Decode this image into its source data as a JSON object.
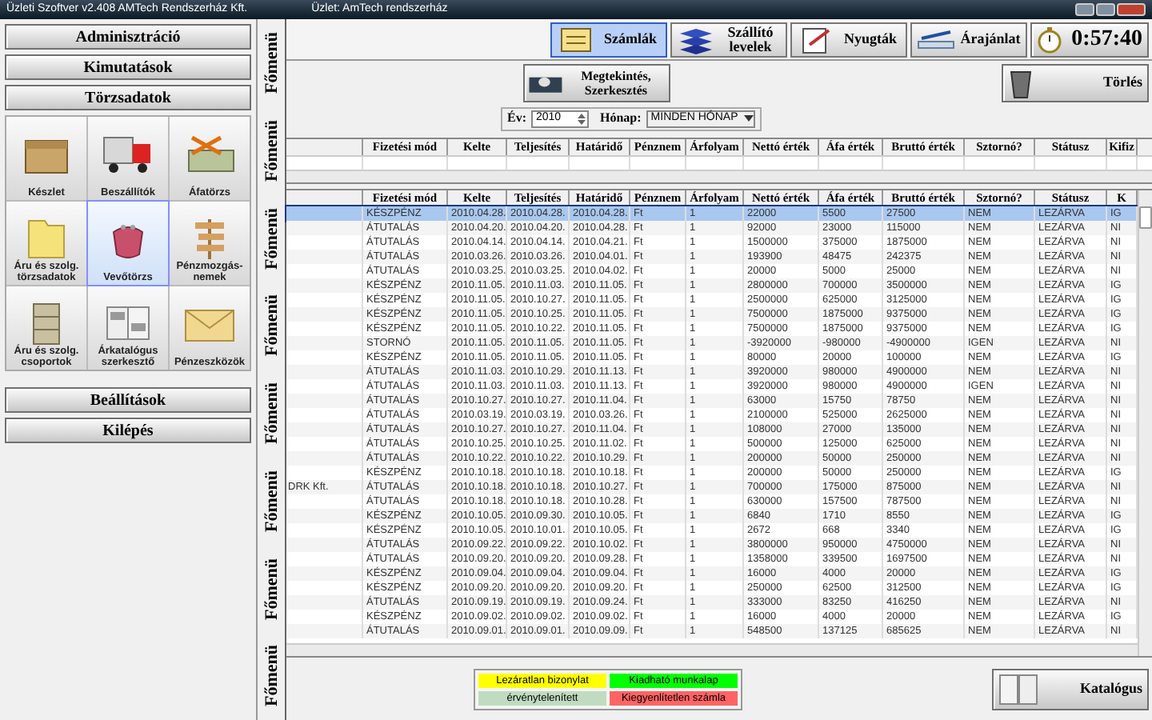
{
  "window": {
    "title": "Üzleti Szoftver v2.408 AMTech Rendszerház Kft.",
    "subtitle": "Üzlet: AmTech rendszerház"
  },
  "sidebar": {
    "top_buttons": [
      "Adminisztráció",
      "Kimutatások",
      "Törzsadatok"
    ],
    "tiles": [
      {
        "label": "Készlet",
        "kind": "box",
        "selected": false
      },
      {
        "label": "Beszállítók",
        "kind": "truck",
        "selected": false
      },
      {
        "label": "Áfatörzs",
        "kind": "money",
        "selected": false
      },
      {
        "label": "Áru és szolg. törzsadatok",
        "kind": "folder",
        "selected": false
      },
      {
        "label": "Vevőtörzs",
        "kind": "purse",
        "selected": true
      },
      {
        "label": "Pénzmozgás-nemek",
        "kind": "sign",
        "selected": false
      },
      {
        "label": "Áru és szolg. csoportok",
        "kind": "cabinet",
        "selected": false
      },
      {
        "label": "Árkatalógus szerkesztő",
        "kind": "catalog",
        "selected": false
      },
      {
        "label": "Pénzeszközök",
        "kind": "envelope",
        "selected": false
      }
    ],
    "bottom_buttons": [
      "Beállítások",
      "Kilépés"
    ]
  },
  "side_tabs": [
    "Főmenü",
    "Főmenü",
    "Főmenü",
    "Főmenü",
    "Főmenü",
    "Főmenü",
    "Főmenü",
    "Főmenü"
  ],
  "toolbar": {
    "buttons": [
      {
        "label": "Számlák",
        "kind": "invoice",
        "selected": true
      },
      {
        "label": "Szállító levelek",
        "kind": "trays",
        "selected": false
      },
      {
        "label": "Nyugták",
        "kind": "receipt",
        "selected": false
      },
      {
        "label": "Árajánlat",
        "kind": "pen",
        "selected": false
      }
    ],
    "timer": "0:57:40"
  },
  "actions": {
    "view_button": "Megtekintés, Szerkesztés",
    "delete_button": "Törlés"
  },
  "filters": {
    "year_label": "Év:",
    "year": "2010",
    "month_label": "Hónap:",
    "month": "MINDEN HÓNAP"
  },
  "upper_table": {
    "columns": [
      "Fizetési mód",
      "Kelte",
      "Teljesítés",
      "Határidő",
      "Pénznem",
      "Árfolyam",
      "Nettó érték",
      "Áfa érték",
      "Bruttó érték",
      "Sztornó?",
      "Státusz",
      "Kifiz"
    ]
  },
  "table": {
    "columns": [
      "Fizetési mód",
      "Kelte",
      "Teljesítés",
      "Határidő",
      "Pénznem",
      "Árfolyam",
      "Nettó érték",
      "Áfa érték",
      "Bruttó érték",
      "Sztornó?",
      "Státusz",
      "K"
    ],
    "rows": [
      {
        "selected": true,
        "cells": [
          "KÉSZPÉNZ",
          "2010.04.28.",
          "2010.04.28.",
          "2010.04.28.",
          "Ft",
          "1",
          "22000",
          "5500",
          "27500",
          "NEM",
          "LEZÁRVA",
          "IG"
        ]
      },
      {
        "selected": false,
        "cells": [
          "ÁTUTALÁS",
          "2010.04.20.",
          "2010.04.20.",
          "2010.04.28.",
          "Ft",
          "1",
          "92000",
          "23000",
          "115000",
          "NEM",
          "LEZÁRVA",
          "NI"
        ]
      },
      {
        "selected": false,
        "cells": [
          "ÁTUTALÁS",
          "2010.04.14.",
          "2010.04.14.",
          "2010.04.21.",
          "Ft",
          "1",
          "1500000",
          "375000",
          "1875000",
          "NEM",
          "LEZÁRVA",
          "NI"
        ]
      },
      {
        "selected": false,
        "cells": [
          "ÁTUTALÁS",
          "2010.03.26.",
          "2010.03.26.",
          "2010.04.01.",
          "Ft",
          "1",
          "193900",
          "48475",
          "242375",
          "NEM",
          "LEZÁRVA",
          "NI"
        ]
      },
      {
        "selected": false,
        "cells": [
          "ÁTUTALÁS",
          "2010.03.25.",
          "2010.03.25.",
          "2010.04.02.",
          "Ft",
          "1",
          "20000",
          "5000",
          "25000",
          "NEM",
          "LEZÁRVA",
          "NI"
        ]
      },
      {
        "selected": false,
        "cells": [
          "KÉSZPÉNZ",
          "2010.11.05.",
          "2010.11.03.",
          "2010.11.05.",
          "Ft",
          "1",
          "2800000",
          "700000",
          "3500000",
          "NEM",
          "LEZÁRVA",
          "IG"
        ]
      },
      {
        "selected": false,
        "cells": [
          "KÉSZPÉNZ",
          "2010.11.05.",
          "2010.10.27.",
          "2010.11.05.",
          "Ft",
          "1",
          "2500000",
          "625000",
          "3125000",
          "NEM",
          "LEZÁRVA",
          "IG"
        ]
      },
      {
        "selected": false,
        "cells": [
          "KÉSZPÉNZ",
          "2010.11.05.",
          "2010.10.25.",
          "2010.11.05.",
          "Ft",
          "1",
          "7500000",
          "1875000",
          "9375000",
          "NEM",
          "LEZÁRVA",
          "IG"
        ]
      },
      {
        "selected": false,
        "cells": [
          "KÉSZPÉNZ",
          "2010.11.05.",
          "2010.10.22.",
          "2010.11.05.",
          "Ft",
          "1",
          "7500000",
          "1875000",
          "9375000",
          "NEM",
          "LEZÁRVA",
          "IG"
        ]
      },
      {
        "selected": false,
        "cells": [
          "STORNÓ",
          "2010.11.05.",
          "2010.11.05.",
          "2010.11.05.",
          "Ft",
          "1",
          "-3920000",
          "-980000",
          "-4900000",
          "IGEN",
          "LEZÁRVA",
          "NI"
        ]
      },
      {
        "selected": false,
        "cells": [
          "KÉSZPÉNZ",
          "2010.11.05.",
          "2010.11.05.",
          "2010.11.05.",
          "Ft",
          "1",
          "80000",
          "20000",
          "100000",
          "NEM",
          "LEZÁRVA",
          "IG"
        ]
      },
      {
        "selected": false,
        "cells": [
          "ÁTUTALÁS",
          "2010.11.03.",
          "2010.10.29.",
          "2010.11.13.",
          "Ft",
          "1",
          "3920000",
          "980000",
          "4900000",
          "NEM",
          "LEZÁRVA",
          "NI"
        ]
      },
      {
        "selected": false,
        "cells": [
          "ÁTUTALÁS",
          "2010.11.03.",
          "2010.11.03.",
          "2010.11.13.",
          "Ft",
          "1",
          "3920000",
          "980000",
          "4900000",
          "IGEN",
          "LEZÁRVA",
          "NI"
        ]
      },
      {
        "selected": false,
        "cells": [
          "ÁTUTALÁS",
          "2010.10.27.",
          "2010.10.27.",
          "2010.11.04.",
          "Ft",
          "1",
          "63000",
          "15750",
          "78750",
          "NEM",
          "LEZÁRVA",
          "NI"
        ]
      },
      {
        "selected": false,
        "cells": [
          "ÁTUTALÁS",
          "2010.03.19.",
          "2010.03.19.",
          "2010.03.26.",
          "Ft",
          "1",
          "2100000",
          "525000",
          "2625000",
          "NEM",
          "LEZÁRVA",
          "NI"
        ]
      },
      {
        "selected": false,
        "cells": [
          "ÁTUTALÁS",
          "2010.10.27.",
          "2010.10.27.",
          "2010.11.04.",
          "Ft",
          "1",
          "108000",
          "27000",
          "135000",
          "NEM",
          "LEZÁRVA",
          "NI"
        ]
      },
      {
        "selected": false,
        "cells": [
          "ÁTUTALÁS",
          "2010.10.25.",
          "2010.10.25.",
          "2010.11.02.",
          "Ft",
          "1",
          "500000",
          "125000",
          "625000",
          "NEM",
          "LEZÁRVA",
          "NI"
        ]
      },
      {
        "selected": false,
        "cells": [
          "ÁTUTALÁS",
          "2010.10.22.",
          "2010.10.22.",
          "2010.10.29.",
          "Ft",
          "1",
          "200000",
          "50000",
          "250000",
          "NEM",
          "LEZÁRVA",
          "NI"
        ]
      },
      {
        "selected": false,
        "cells": [
          "KÉSZPÉNZ",
          "2010.10.18.",
          "2010.10.18.",
          "2010.10.18.",
          "Ft",
          "1",
          "200000",
          "50000",
          "250000",
          "NEM",
          "LEZÁRVA",
          "IG"
        ]
      },
      {
        "selected": false,
        "column_1": "DRK Kft.",
        "cells": [
          "ÁTUTALÁS",
          "2010.10.18.",
          "2010.10.18.",
          "2010.10.27.",
          "Ft",
          "1",
          "700000",
          "175000",
          "875000",
          "NEM",
          "LEZÁRVA",
          "NI"
        ]
      },
      {
        "selected": false,
        "cells": [
          "ÁTUTALÁS",
          "2010.10.18.",
          "2010.10.18.",
          "2010.10.28.",
          "Ft",
          "1",
          "630000",
          "157500",
          "787500",
          "NEM",
          "LEZÁRVA",
          "NI"
        ]
      },
      {
        "selected": false,
        "cells": [
          "KÉSZPÉNZ",
          "2010.10.05.",
          "2010.09.30.",
          "2010.10.05.",
          "Ft",
          "1",
          "6840",
          "1710",
          "8550",
          "NEM",
          "LEZÁRVA",
          "IG"
        ]
      },
      {
        "selected": false,
        "cells": [
          "KÉSZPÉNZ",
          "2010.10.05.",
          "2010.10.01.",
          "2010.10.05.",
          "Ft",
          "1",
          "2672",
          "668",
          "3340",
          "NEM",
          "LEZÁRVA",
          "IG"
        ]
      },
      {
        "selected": false,
        "cells": [
          "ÁTUTALÁS",
          "2010.09.22.",
          "2010.09.22.",
          "2010.10.02.",
          "Ft",
          "1",
          "3800000",
          "950000",
          "4750000",
          "NEM",
          "LEZÁRVA",
          "NI"
        ]
      },
      {
        "selected": false,
        "cells": [
          "ÁTUTALÁS",
          "2010.09.20.",
          "2010.09.20.",
          "2010.09.28.",
          "Ft",
          "1",
          "1358000",
          "339500",
          "1697500",
          "NEM",
          "LEZÁRVA",
          "NI"
        ]
      },
      {
        "selected": false,
        "cells": [
          "KÉSZPÉNZ",
          "2010.09.04.",
          "2010.09.04.",
          "2010.09.04.",
          "Ft",
          "1",
          "16000",
          "4000",
          "20000",
          "NEM",
          "LEZÁRVA",
          "IG"
        ]
      },
      {
        "selected": false,
        "cells": [
          "KÉSZPÉNZ",
          "2010.09.20.",
          "2010.09.20.",
          "2010.09.20.",
          "Ft",
          "1",
          "250000",
          "62500",
          "312500",
          "NEM",
          "LEZÁRVA",
          "IG"
        ]
      },
      {
        "selected": false,
        "cells": [
          "ÁTUTALÁS",
          "2010.09.19.",
          "2010.09.19.",
          "2010.09.24.",
          "Ft",
          "1",
          "333000",
          "83250",
          "416250",
          "NEM",
          "LEZÁRVA",
          "NI"
        ]
      },
      {
        "selected": false,
        "cells": [
          "KÉSZPÉNZ",
          "2010.09.02.",
          "2010.09.02.",
          "2010.09.02.",
          "Ft",
          "1",
          "16000",
          "4000",
          "20000",
          "NEM",
          "LEZÁRVA",
          "IG"
        ]
      },
      {
        "selected": false,
        "cells": [
          "ÁTUTALÁS",
          "2010.09.01.",
          "2010.09.01.",
          "2010.09.09.",
          "Ft",
          "1",
          "548500",
          "137125",
          "685625",
          "NEM",
          "LEZÁRVA",
          "NI"
        ]
      }
    ]
  },
  "legend": [
    {
      "label": "Lezáratlan bizonylat",
      "color": "#ffff00"
    },
    {
      "label": "Kiadható munkalap",
      "color": "#00ff00"
    },
    {
      "label": "érvénytelenített",
      "color": "#c0dcc0"
    },
    {
      "label": "Kiegyenlítetlen számla",
      "color": "#ff6464"
    }
  ],
  "catalog_button": "Katalógus"
}
